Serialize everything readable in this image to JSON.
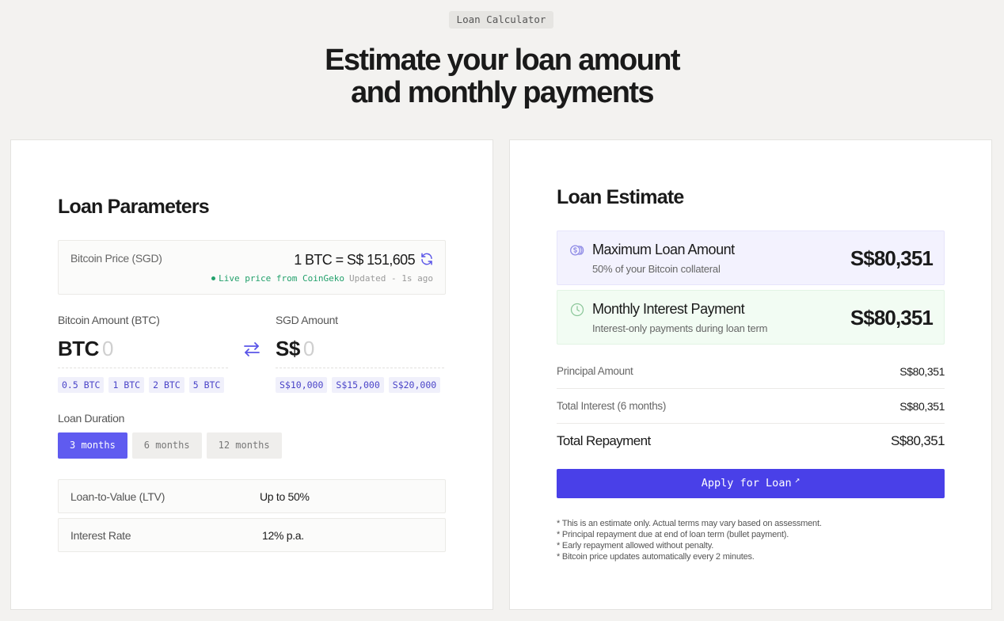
{
  "header": {
    "badge": "Loan Calculator",
    "headline_line1": "Estimate your loan amount",
    "headline_line2": "and monthly payments"
  },
  "params": {
    "title": "Loan Parameters",
    "price": {
      "label": "Bitcoin Price (SGD)",
      "value": "1 BTC = S$ 151,605",
      "live_text": "Live price from CoinGeko",
      "updated_text": "Updated - 1s ago",
      "refresh_icon": "refresh-icon",
      "live_color": "#22a06b"
    },
    "btc": {
      "label": "Bitcoin Amount (BTC)",
      "prefix": "BTC",
      "placeholder": "0",
      "chips": [
        "0.5 BTC",
        "1 BTC",
        "2 BTC",
        "5 BTC"
      ]
    },
    "swap_icon": "swap-arrows-icon",
    "sgd": {
      "label": "SGD Amount",
      "prefix": "S$",
      "placeholder": "0",
      "chips": [
        "S$10,000",
        "S$15,000",
        "S$20,000"
      ]
    },
    "duration": {
      "label": "Loan Duration",
      "options": [
        "3 months",
        "6 months",
        "12 months"
      ],
      "selected": "3 months",
      "accent": "#5f5bf0"
    },
    "info": [
      {
        "label": "Loan-to-Value (LTV)",
        "value": "Up to 50%"
      },
      {
        "label": "Interest Rate",
        "value": "12% p.a."
      }
    ]
  },
  "estimate": {
    "title": "Loan Estimate",
    "max": {
      "title": "Maximum Loan Amount",
      "subtitle": "50% of your Bitcoin collateral",
      "value": "S$80,351",
      "icon": "coins-icon"
    },
    "monthly": {
      "title": "Monthly Interest Payment",
      "subtitle": "Interest-only payments during loan term",
      "value": "S$80,351",
      "icon": "clock-icon"
    },
    "summary": [
      {
        "label": "Principal Amount",
        "value": "S$80,351"
      },
      {
        "label": "Total Interest (6 months)",
        "value": "S$80,351"
      },
      {
        "label": "Total Repayment",
        "value": "S$80,351"
      }
    ],
    "apply_label": "Apply for Loan",
    "apply_arrow": "↗",
    "apply_color": "#4940e8",
    "notes": [
      "* This is an estimate only. Actual terms may vary based on assessment.",
      "* Principal repayment due at end of loan term (bullet payment).",
      "* Early repayment allowed without penalty.",
      "* Bitcoin price updates automatically every 2 minutes."
    ]
  }
}
